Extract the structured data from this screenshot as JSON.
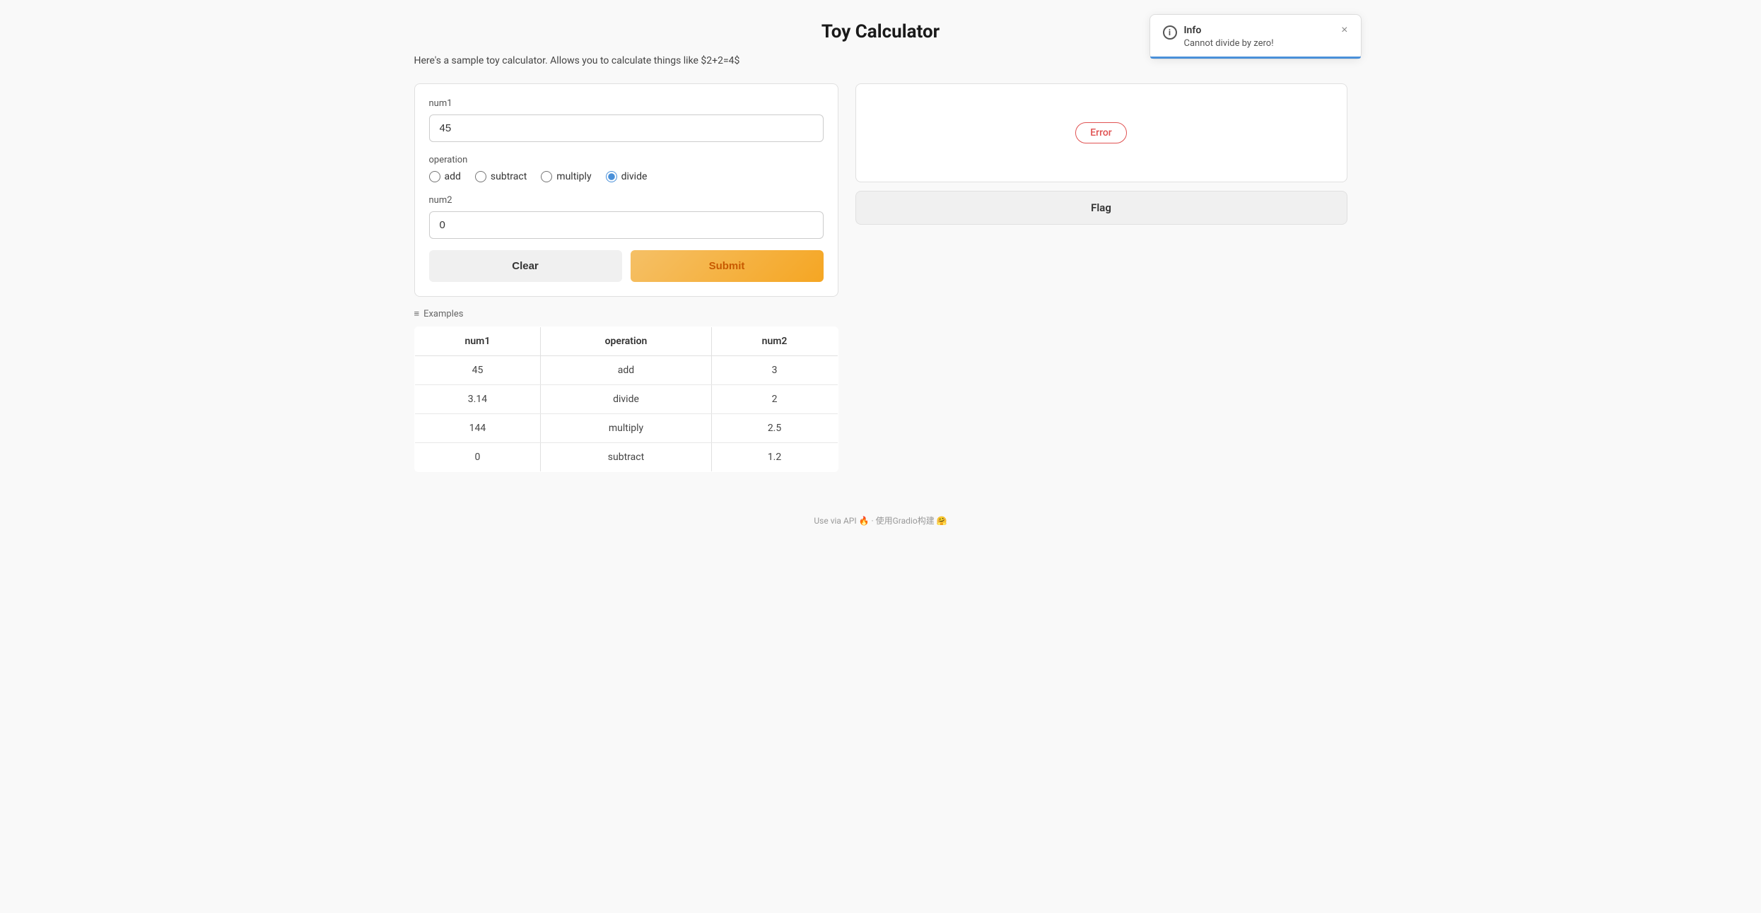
{
  "page": {
    "title": "Toy Calculator",
    "subtitle": "Here's a sample toy calculator. Allows you to calculate things like $2+2=4$"
  },
  "toast": {
    "title": "Info",
    "message": "Cannot divide by zero!",
    "close_label": "×"
  },
  "form": {
    "num1_label": "num1",
    "num1_value": "45",
    "operation_label": "operation",
    "operations": [
      {
        "label": "add",
        "value": "add"
      },
      {
        "label": "subtract",
        "value": "subtract"
      },
      {
        "label": "multiply",
        "value": "multiply"
      },
      {
        "label": "divide",
        "value": "divide"
      }
    ],
    "num2_label": "num2",
    "num2_value": "0"
  },
  "buttons": {
    "clear": "Clear",
    "submit": "Submit"
  },
  "examples": {
    "header": "≡ Examples",
    "columns": [
      "num1",
      "operation",
      "num2"
    ],
    "rows": [
      {
        "num1": "45",
        "operation": "add",
        "num2": "3"
      },
      {
        "num1": "3.14",
        "operation": "divide",
        "num2": "2"
      },
      {
        "num1": "144",
        "operation": "multiply",
        "num2": "2.5"
      },
      {
        "num1": "0",
        "operation": "subtract",
        "num2": "1.2"
      }
    ]
  },
  "output": {
    "error_label": "Error",
    "flag_label": "Flag"
  },
  "footer": {
    "api_text": "Use via API",
    "built_text": "· 使用Gradio构建 🤗"
  }
}
